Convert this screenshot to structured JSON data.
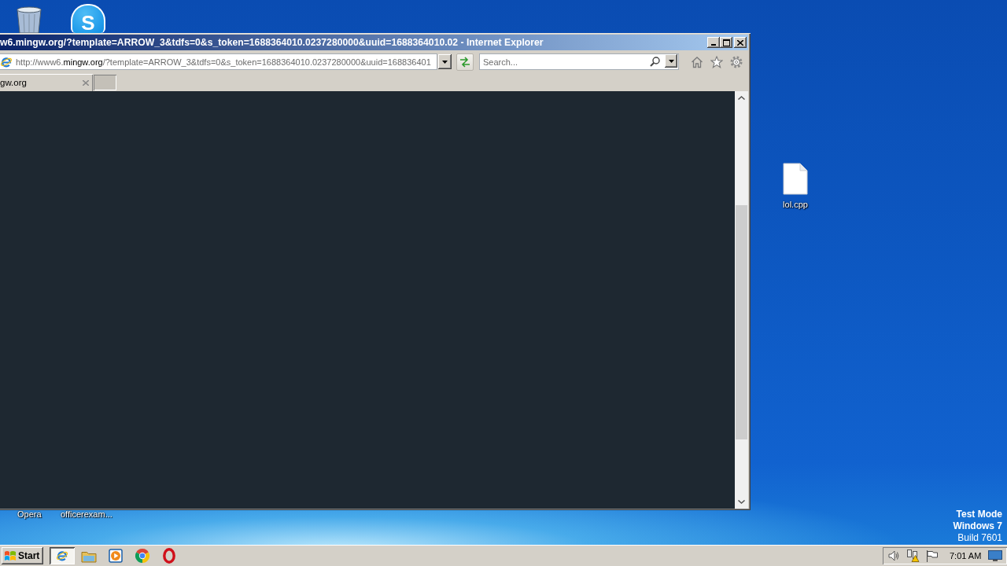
{
  "desktop": {
    "app_logo_letter": "S",
    "file_icons": [
      {
        "label": "lol.cpp"
      }
    ],
    "covered_icon_labels": [
      "Opera",
      "officerexam..."
    ],
    "system_notice": [
      {
        "text": "Test Mode",
        "bold": true
      },
      {
        "text": "Windows 7",
        "bold": true
      },
      {
        "text": "Build 7601",
        "bold": false
      }
    ]
  },
  "browser": {
    "title": "w6.mingw.org/?template=ARROW_3&tdfs=0&s_token=1688364010.0237280000&uuid=1688364010.02 - Internet Explorer",
    "address": {
      "prefix": "http://www6.",
      "domain": "mingw.org",
      "rest": "/?template=ARROW_3&tdfs=0&s_token=1688364010.0237280000&uuid=168836401"
    },
    "search": {
      "placeholder": "Search..."
    },
    "tabs": [
      {
        "label": "gw.org",
        "selected": true
      }
    ]
  },
  "taskbar": {
    "start_label": "Start",
    "apps": [
      {
        "kind": "browser",
        "selected": true
      },
      {
        "kind": "folder",
        "selected": false
      },
      {
        "kind": "player",
        "selected": false
      },
      {
        "kind": "wheel",
        "selected": false
      },
      {
        "kind": "ring",
        "selected": false
      }
    ],
    "clock": "7:01 AM"
  }
}
